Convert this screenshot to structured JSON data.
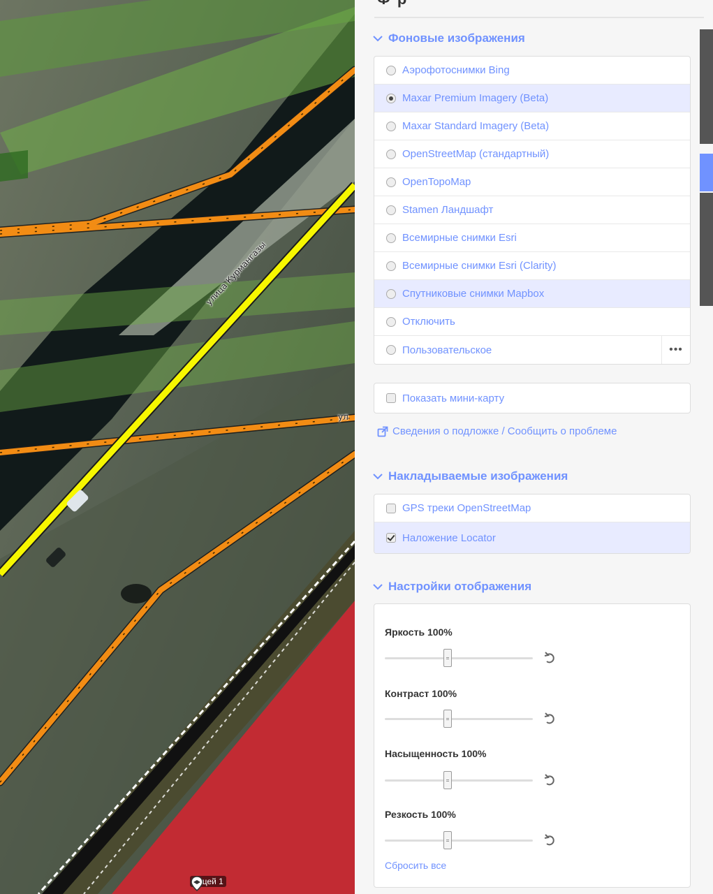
{
  "map": {
    "street_labels": [
      "улица Курмангазы",
      "ул"
    ],
    "poi_label": "лицей 1"
  },
  "panel": {
    "title_fragment": "Ф         р",
    "background_section": {
      "title": "Фоновые изображения",
      "items": [
        {
          "label": "Аэрофотоснимки Bing",
          "selected": false
        },
        {
          "label": "Maxar Premium Imagery (Beta)",
          "selected": true
        },
        {
          "label": "Maxar Standard Imagery (Beta)",
          "selected": false
        },
        {
          "label": "OpenStreetMap (стандартный)",
          "selected": false
        },
        {
          "label": "OpenTopoMap",
          "selected": false
        },
        {
          "label": "Stamen Ландшафт",
          "selected": false
        },
        {
          "label": "Всемирные снимки Esri",
          "selected": false
        },
        {
          "label": "Всемирные снимки Esri (Clarity)",
          "selected": false
        },
        {
          "label": "Спутниковые снимки Mapbox",
          "selected": false
        },
        {
          "label": "Отключить",
          "selected": false
        },
        {
          "label": "Пользовательское",
          "selected": false
        }
      ],
      "more_label": "•••",
      "minimap_label": "Показать мини-карту",
      "info_link": "Сведения о подложке / Сообщить о проблеме"
    },
    "overlay_section": {
      "title": "Накладываемые изображения",
      "items": [
        {
          "label": "GPS треки OpenStreetMap",
          "checked": false
        },
        {
          "label": "Наложение Locator",
          "checked": true
        }
      ]
    },
    "display_section": {
      "title": "Настройки отображения",
      "sliders": [
        {
          "label": "Яркость 100%",
          "value": 100
        },
        {
          "label": "Контраст 100%",
          "value": 100
        },
        {
          "label": "Насыщенность 100%",
          "value": 100
        },
        {
          "label": "Резкость 100%",
          "value": 100
        }
      ],
      "reset_all": "Сбросить все"
    }
  },
  "colors": {
    "accent": "#7092ff",
    "active_row": "#e8ebff",
    "road_yellow": "#f7f700",
    "road_orange": "#f28c14"
  }
}
